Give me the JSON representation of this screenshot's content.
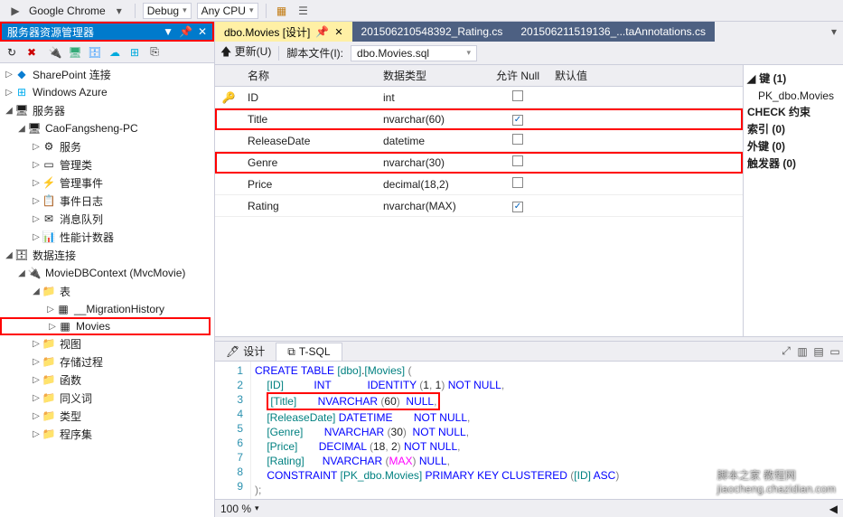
{
  "toolbar": {
    "browser": "Google Chrome",
    "config": "Debug",
    "platform": "Any CPU"
  },
  "left_panel": {
    "title": "服务器资源管理器",
    "tree": {
      "sharepoint": "SharePoint 连接",
      "azure": "Windows Azure",
      "servers": "服务器",
      "pc": "CaoFangsheng-PC",
      "svc": "服务",
      "mgmt": "管理类",
      "events": "管理事件",
      "eventlog": "事件日志",
      "msgq": "消息队列",
      "perf": "性能计数器",
      "dataconn": "数据连接",
      "db": "MovieDBContext (MvcMovie)",
      "tables": "表",
      "migration": "__MigrationHistory",
      "movies": "Movies",
      "views": "视图",
      "sprocs": "存储过程",
      "funcs": "函数",
      "synonyms": "同义词",
      "types": "类型",
      "assemblies": "程序集"
    }
  },
  "tabs": {
    "active": "dbo.Movies [设计]",
    "t2": "201506210548392_Rating.cs",
    "t3": "201506211519136_...taAnnotations.cs"
  },
  "doc_toolbar": {
    "update": "更新(U)",
    "script_label": "脚本文件(I):",
    "script_file": "dbo.Movies.sql"
  },
  "grid": {
    "headers": {
      "name": "名称",
      "type": "数据类型",
      "null": "允许 Null",
      "def": "默认值"
    },
    "rows": [
      {
        "key": true,
        "name": "ID",
        "type": "int",
        "null": false,
        "hi": false
      },
      {
        "key": false,
        "name": "Title",
        "type": "nvarchar(60)",
        "null": true,
        "hi": true
      },
      {
        "key": false,
        "name": "ReleaseDate",
        "type": "datetime",
        "null": false,
        "hi": false
      },
      {
        "key": false,
        "name": "Genre",
        "type": "nvarchar(30)",
        "null": false,
        "hi": true
      },
      {
        "key": false,
        "name": "Price",
        "type": "decimal(18,2)",
        "null": false,
        "hi": false
      },
      {
        "key": false,
        "name": "Rating",
        "type": "nvarchar(MAX)",
        "null": true,
        "hi": false
      }
    ]
  },
  "keys_panel": {
    "keys_hdr": "键 (1)",
    "pk": "PK_dbo.Movies",
    "check": "CHECK 约束",
    "index": "索引 (0)",
    "fk": "外键 (0)",
    "trigger": "触发器 (0)"
  },
  "bottom_tabs": {
    "design": "设计",
    "tsql": "T-SQL"
  },
  "sql": {
    "lines": [
      "CREATE TABLE [dbo].[Movies] (",
      "    [ID]          INT            IDENTITY (1, 1) NOT NULL,",
      "    [Title]       NVARCHAR (60)  NULL,",
      "    [ReleaseDate] DATETIME       NOT NULL,",
      "    [Genre]       NVARCHAR (30)  NOT NULL,",
      "    [Price]       DECIMAL (18, 2) NOT NULL,",
      "    [Rating]      NVARCHAR (MAX) NULL,",
      "    CONSTRAINT [PK_dbo.Movies] PRIMARY KEY CLUSTERED ([ID] ASC)",
      ");"
    ]
  },
  "status": {
    "zoom": "100 %"
  },
  "watermark": {
    "l1": "脚本之家 教程网",
    "l2": "jiaocheng.chazidian.com"
  }
}
